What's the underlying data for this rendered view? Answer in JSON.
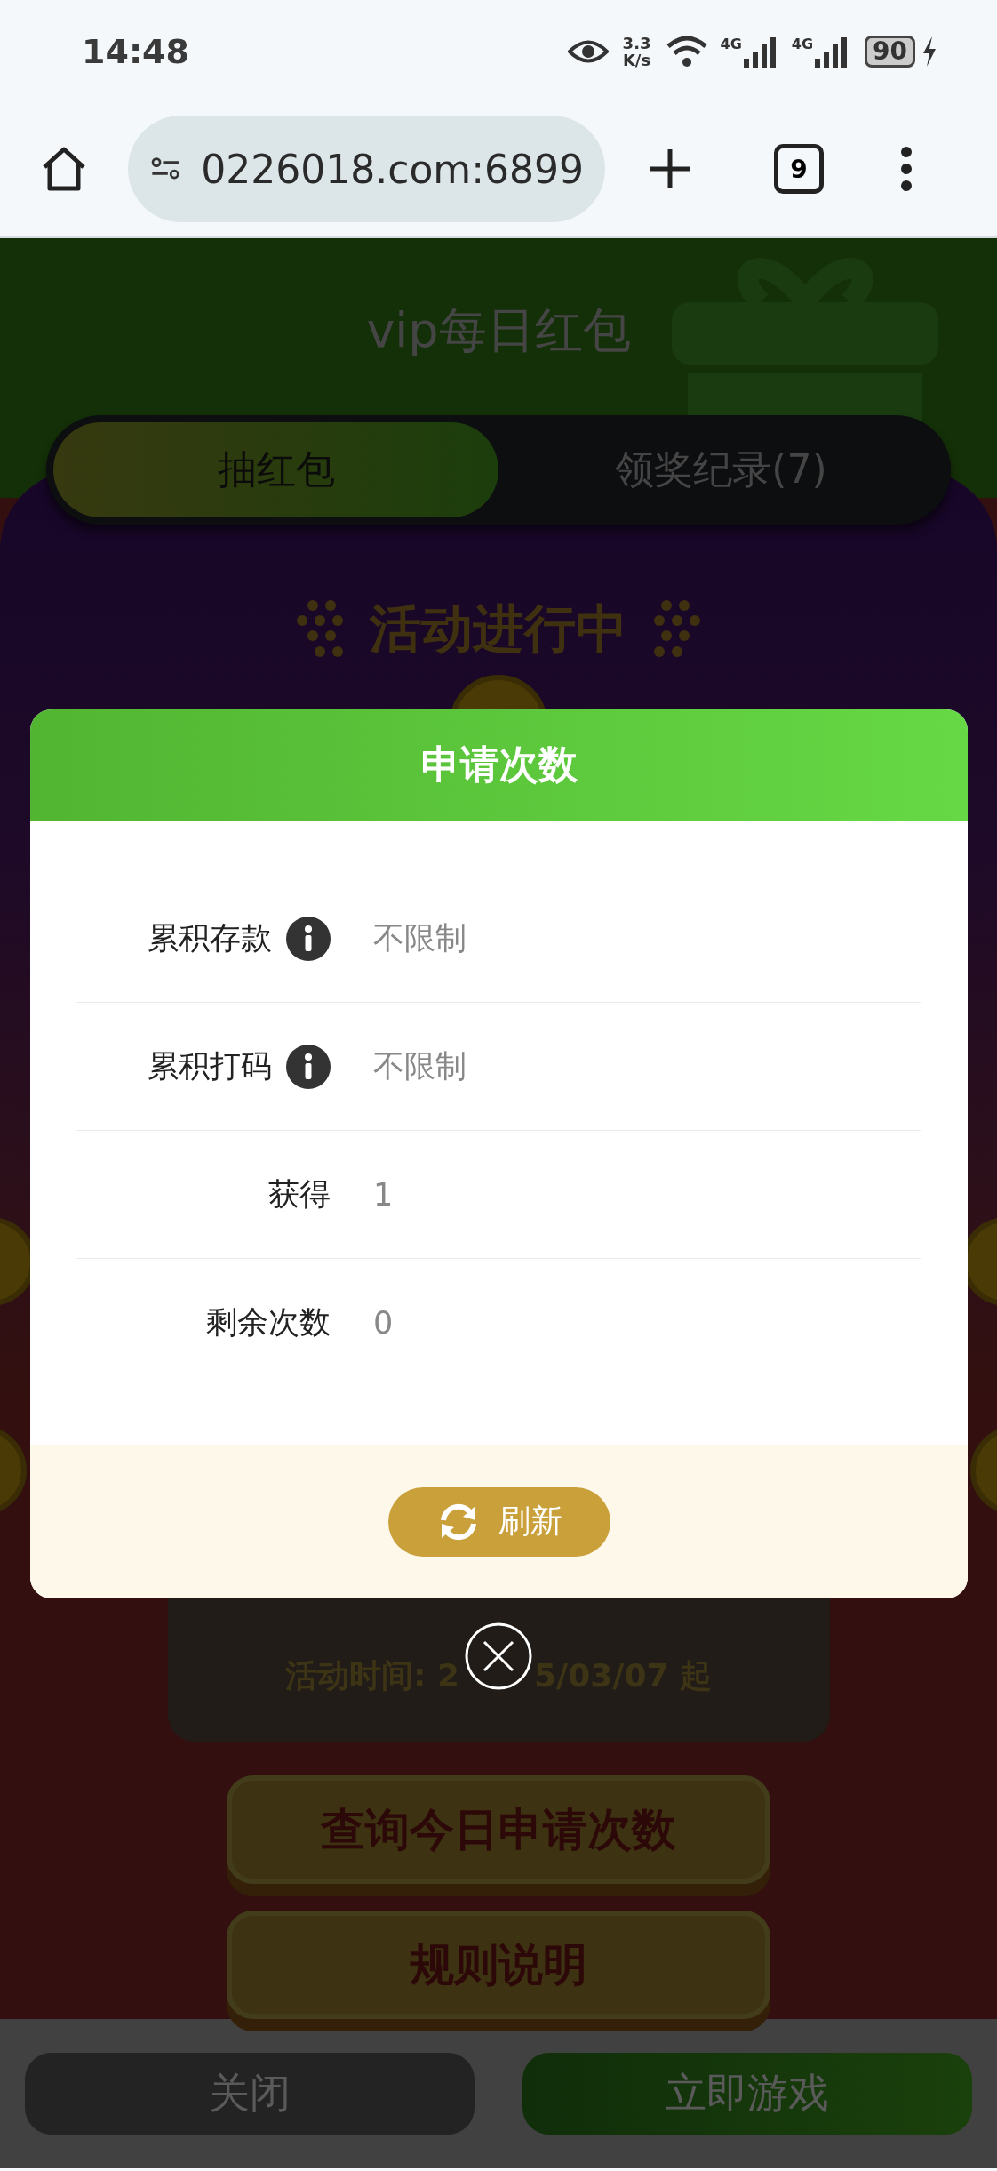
{
  "status_bar": {
    "time": "14:48",
    "net_speed": [
      "3.3",
      "K/s"
    ],
    "networks": [
      "4G",
      "4G"
    ],
    "battery": "90"
  },
  "browser": {
    "url": "0226018.com:6899",
    "tab_count": "9"
  },
  "page": {
    "title": "vip每日红包",
    "tabs": [
      {
        "label": "抽红包",
        "selected": true
      },
      {
        "label": "领奖纪录(7)",
        "selected": false
      }
    ],
    "status_heading": "活动进行中",
    "activity_time": [
      "活动时间: 2",
      "5/03/07 起"
    ],
    "buttons": [
      "查询今日申请次数",
      "规则说明"
    ],
    "bottom_buttons": [
      {
        "label": "关闭",
        "kind": "close"
      },
      {
        "label": "立即游戏",
        "kind": "play"
      }
    ]
  },
  "modal": {
    "title": "申请次数",
    "rows": [
      {
        "label": "累积存款",
        "info": true,
        "value": "不限制"
      },
      {
        "label": "累积打码",
        "info": true,
        "value": "不限制"
      },
      {
        "label": "获得",
        "info": false,
        "value": "1"
      },
      {
        "label": "剩余次数",
        "info": false,
        "value": "0"
      }
    ],
    "refresh_button": "刷新"
  }
}
